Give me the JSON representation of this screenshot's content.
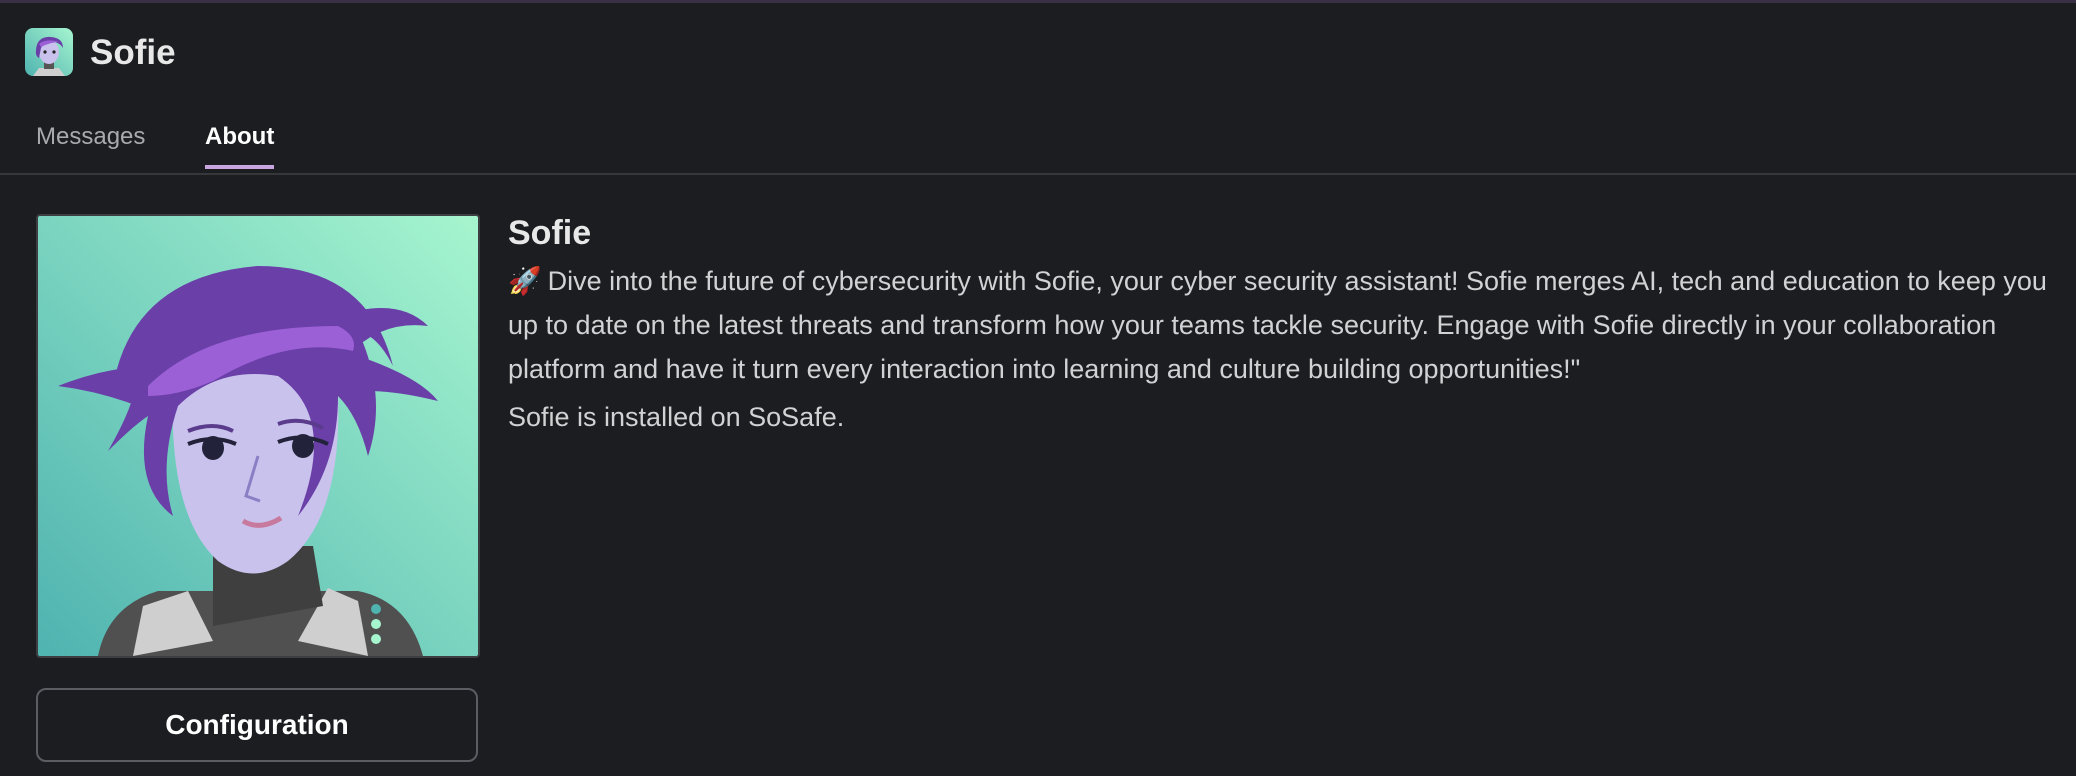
{
  "header": {
    "title": "Sofie",
    "avatar_icon": "sofie-avatar-icon"
  },
  "tabs": [
    {
      "label": "Messages",
      "active": false
    },
    {
      "label": "About",
      "active": true
    }
  ],
  "about": {
    "name": "Sofie",
    "description_icon": "🚀",
    "description": "Dive into the future of cybersecurity with Sofie, your cyber security assistant! Sofie merges AI, tech and education to keep you up to date on the latest threats and transform how your teams tackle security. Engage with Sofie directly in your collaboration platform and have it turn every interaction into learning and culture building opportunities!\"",
    "installed_text": "Sofie is installed on SoSafe."
  },
  "config_button": {
    "label": "Configuration"
  },
  "colors": {
    "background": "#1b1d21",
    "active_tab_underline": "#c9a6e0",
    "portrait_bg_top": "#a6f5cf",
    "portrait_bg_bottom": "#4fb3b0",
    "hair": "#6a3fa8",
    "hair_highlight": "#9b5fd6",
    "skin": "#c8c2ec"
  }
}
